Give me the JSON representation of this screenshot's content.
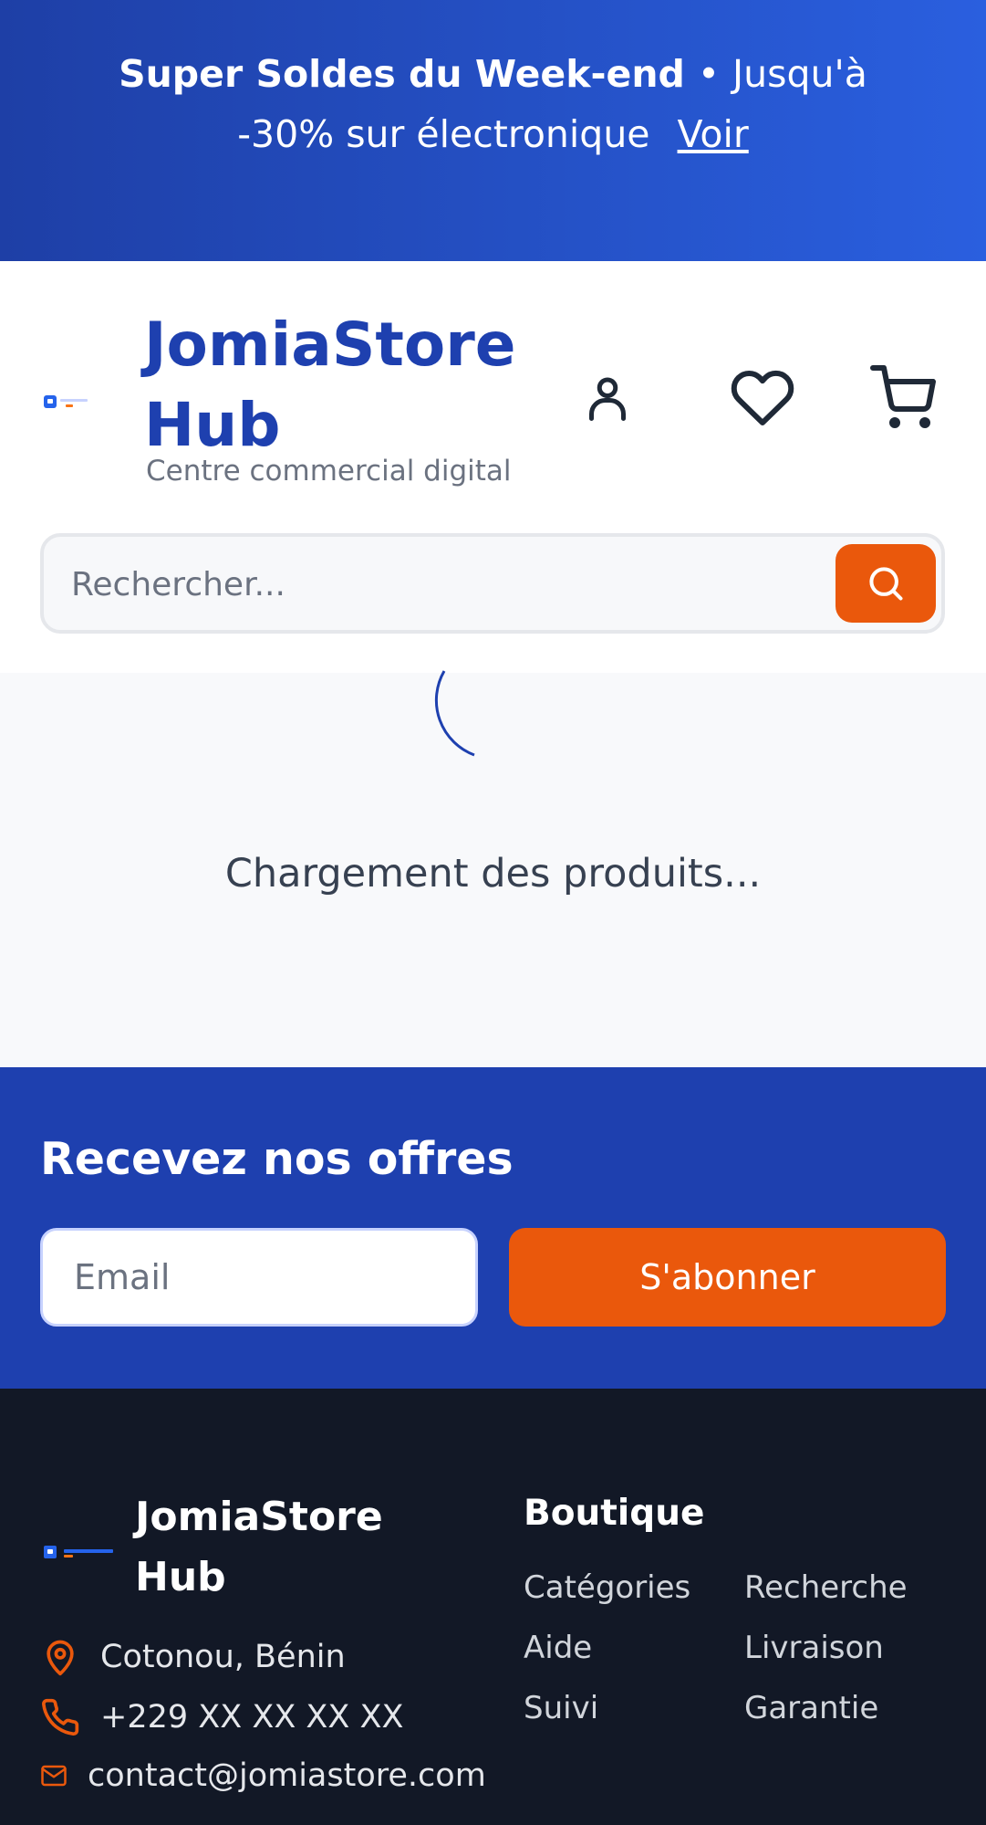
{
  "promo": {
    "headline": "Super Soldes du Week-end",
    "separator": "•",
    "text_line1": "Jusqu'à",
    "text_line2": "-30% sur électronique",
    "link": "Voir"
  },
  "header": {
    "brand_line1": "JomiaStore",
    "brand_line2": "Hub",
    "tagline": "Centre commercial digital",
    "icons": [
      "user-icon",
      "heart-icon",
      "cart-icon"
    ]
  },
  "search": {
    "placeholder": "Rechercher..."
  },
  "main": {
    "loading_text": "Chargement des produits..."
  },
  "newsletter": {
    "title": "Recevez nos offres",
    "email_placeholder": "Email",
    "subscribe_label": "S'abonner"
  },
  "footer": {
    "brand_line1": "JomiaStore",
    "brand_line2": "Hub",
    "address": "Cotonou, Bénin",
    "phone": "+229 XX XX XX XX",
    "email": "contact@jomiastore.com",
    "shop_heading": "Boutique",
    "links": [
      "Catégories",
      "Recherche",
      "Aide",
      "Livraison",
      "Suivi",
      "Garantie"
    ]
  },
  "colors": {
    "brand_blue": "#1e40af",
    "accent_orange": "#ea580c",
    "footer_bg": "#121826"
  }
}
